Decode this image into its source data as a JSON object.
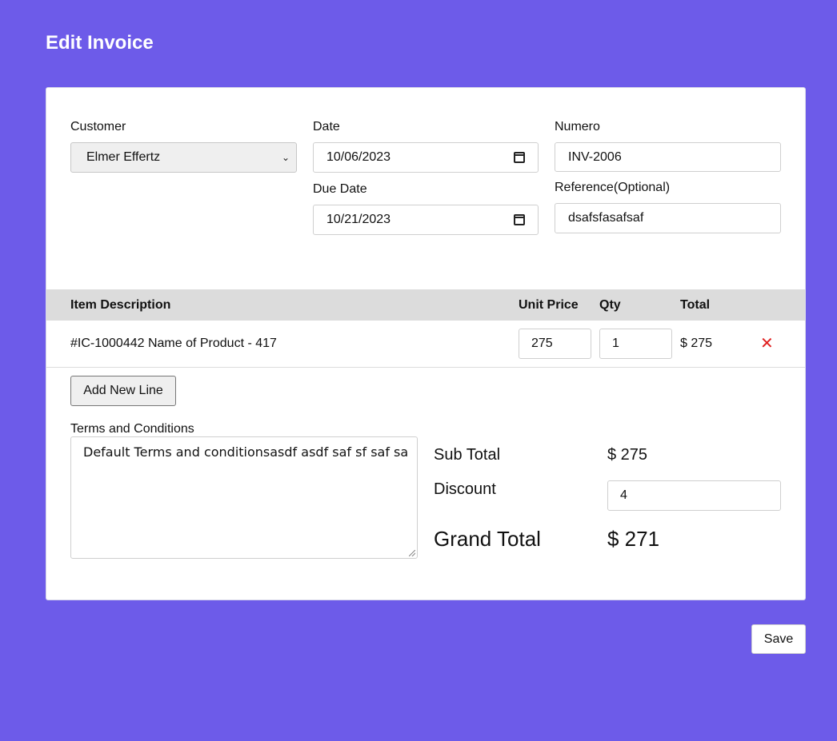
{
  "page": {
    "title": "Edit Invoice"
  },
  "form": {
    "customer": {
      "label": "Customer",
      "value": "Elmer Effertz"
    },
    "date": {
      "label": "Date",
      "value": "10/06/2023"
    },
    "due_date": {
      "label": "Due Date",
      "value": "10/21/2023"
    },
    "numero": {
      "label": "Numero",
      "value": "INV-2006"
    },
    "reference": {
      "label": "Reference(Optional)",
      "value": "dsafsfasafsaf"
    }
  },
  "items": {
    "headers": {
      "description": "Item Description",
      "unit_price": "Unit Price",
      "qty": "Qty",
      "total": "Total"
    },
    "rows": [
      {
        "description": "#IC-1000442 Name of Product - 417",
        "unit_price": "275",
        "qty": "1",
        "total": "$ 275",
        "remove_icon": "close-icon"
      }
    ],
    "add_label": "Add New Line"
  },
  "terms": {
    "label": "Terms and Conditions",
    "value": "Default Terms and conditionsasdf asdf saf sf saf sa"
  },
  "summary": {
    "subtotal_label": "Sub Total",
    "subtotal_value": "$ 275",
    "discount_label": "Discount",
    "discount_value": "4",
    "grand_label": "Grand Total",
    "grand_value": "$ 271"
  },
  "actions": {
    "save_label": "Save"
  },
  "colors": {
    "background": "#6d5be9",
    "remove": "#e02020"
  }
}
